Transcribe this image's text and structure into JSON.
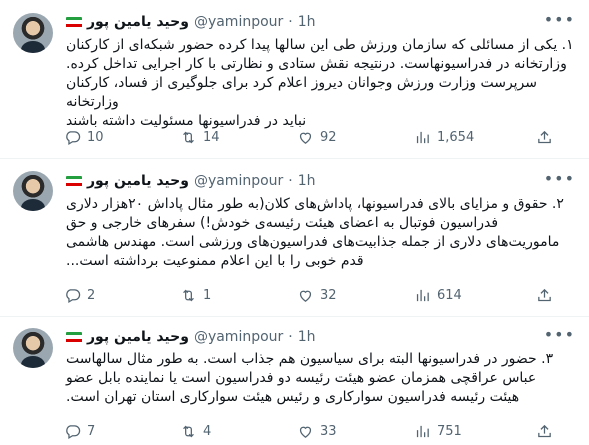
{
  "tweets": [
    {
      "name": "وحید یامین پور",
      "handle": "@yaminpour",
      "dot": "·",
      "time": "1h",
      "lines": [
        "۱. یکی از مسائلی که سازمان ورزش طی این سالها پیدا کرده حضور شبکه‌ای از کارکنان",
        "وزارتخانه در فدراسیونهاست. درنتیجه نقش ستادی و نظارتی با کار اجرایی تداخل کرده.",
        "سرپرست وزارت ورزش وجوانان دیروز اعلام کرد برای جلوگیری از فساد، کارکنان وزارتخانه",
        "نباید در فدراسیونها مسئولیت داشته باشند"
      ],
      "replies": "10",
      "retweets": "14",
      "likes": "92",
      "views": "1,654"
    },
    {
      "name": "وحید یامین پور",
      "handle": "@yaminpour",
      "dot": "·",
      "time": "1h",
      "lines": [
        "۲. حقوق و مزایای بالای فدراسیونها، پاداش‌های کلان(به طور مثال پاداش ۲۰هزار دلاری",
        "فدراسیون فوتبال به اعضای هیئت رئیسه‌ی خودش!) سفرهای خارجی و حق",
        "ماموریت‌های دلاری از جمله جذابیت‌های فدراسیون‌های ورزشی است. مهندس هاشمی",
        "قدم خوبی را با این اعلام ممنوعیت برداشته است..."
      ],
      "replies": "2",
      "retweets": "1",
      "likes": "32",
      "views": "614"
    },
    {
      "name": "وحید یامین پور",
      "handle": "@yaminpour",
      "dot": "·",
      "time": "1h",
      "lines": [
        "۳. حضور در فدراسیونها البته برای سیاسیون هم جذاب است. به طور مثال سالهاست",
        "عباس عراقچی همزمان عضو هیئت رئیسه دو فدراسیون است یا نماینده بابل عضو",
        "هیئت رئیسه فدراسیون سوارکاری و رئیس هیئت سوارکاری استان تهران است."
      ],
      "replies": "7",
      "retweets": "4",
      "likes": "33",
      "views": "751"
    }
  ],
  "icons": {
    "reply": "reply-icon",
    "retweet": "retweet-icon",
    "like": "heart-icon",
    "views": "views-chart-icon",
    "share": "share-icon",
    "more": "more-dots-icon",
    "flag": "iran-flag-icon"
  },
  "colors": {
    "text": "#0f1419",
    "muted": "#536471",
    "divider": "#eff3f4",
    "flag_green": "#239f40",
    "flag_white": "#ffffff",
    "flag_red": "#da0000"
  }
}
